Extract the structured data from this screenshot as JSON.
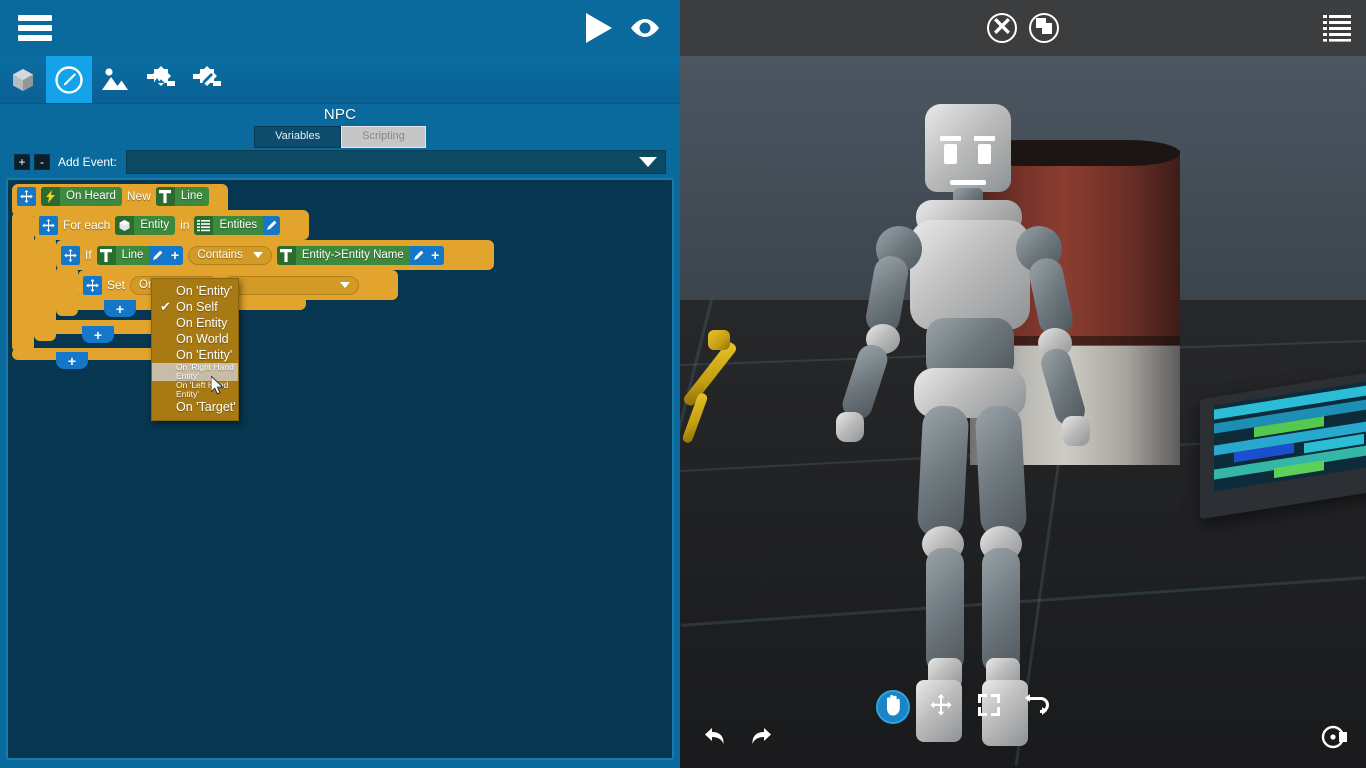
{
  "app": {
    "menu_icon": "hamburger-menu-icon",
    "play_icon": "play-icon",
    "preview_icon": "eye-icon"
  },
  "toolstrip": {
    "items": [
      {
        "icon": "cube-icon",
        "name": "objects-tool",
        "active": false
      },
      {
        "icon": "pencil-circle-icon",
        "name": "edit-tool",
        "active": true
      },
      {
        "icon": "image-icon",
        "name": "scene-tool",
        "active": false
      },
      {
        "icon": "gear-image-icon",
        "name": "settings-scene-tool",
        "active": false
      },
      {
        "icon": "gear-pencil-icon",
        "name": "settings-edit-tool",
        "active": false
      }
    ]
  },
  "object_panel": {
    "title": "NPC",
    "tabs": [
      {
        "label": "Variables",
        "active": false
      },
      {
        "label": "Scripting",
        "active": true
      }
    ]
  },
  "add_event": {
    "add_label": "+",
    "remove_label": "-",
    "label": "Add Event:",
    "value": "",
    "caret": "chevron-down-icon"
  },
  "script": {
    "event_block": {
      "handle": "move-handle-icon",
      "trigger_icon": "lightning-bolt-icon",
      "trigger": "On Heard",
      "mid_label": "New",
      "value_icon": "text-type-icon",
      "value": "Line"
    },
    "foreach_block": {
      "handle": "move-handle-icon",
      "label": "For each",
      "item_icon": "cube-icon",
      "item": "Entity",
      "in_label": "in",
      "list_icon": "list-icon",
      "list": "Entities",
      "edit_icon": "pencil-icon"
    },
    "if_block": {
      "handle": "move-handle-icon",
      "label": "If",
      "left_icon": "text-type-icon",
      "left": "Line",
      "left_edit": "pencil-icon",
      "left_add": "plus-icon",
      "operator": "Contains",
      "right_icon": "text-type-icon",
      "right": "Entity->Entity Name",
      "right_edit": "pencil-icon",
      "right_add": "plus-icon"
    },
    "set_block": {
      "handle": "move-handle-icon",
      "label": "Set",
      "target": "On Self",
      "value": ""
    },
    "add_buttons": [
      {
        "label": "+",
        "name": "add-statement-level-4"
      },
      {
        "label": "+",
        "name": "add-statement-level-3"
      },
      {
        "label": "+",
        "name": "add-statement-level-2"
      },
      {
        "label": "+",
        "name": "add-statement-level-1"
      }
    ]
  },
  "dropdown": {
    "open": true,
    "items": [
      {
        "label": "On 'Entity'",
        "checked": false,
        "small": false,
        "hovered": false
      },
      {
        "label": "On Self",
        "checked": true,
        "small": false,
        "hovered": false
      },
      {
        "label": "On Entity",
        "checked": false,
        "small": false,
        "hovered": false
      },
      {
        "label": "On World",
        "checked": false,
        "small": false,
        "hovered": false
      },
      {
        "label": "On 'Entity'",
        "checked": false,
        "small": false,
        "hovered": false
      },
      {
        "label": "On 'Right Hand Entity'",
        "checked": false,
        "small": true,
        "hovered": true
      },
      {
        "label": "On 'Left Hand Entity'",
        "checked": false,
        "small": true,
        "hovered": false
      },
      {
        "label": "On 'Target'",
        "checked": false,
        "small": false,
        "hovered": false
      }
    ]
  },
  "viewport": {
    "topbar": [
      {
        "icon": "close-circle-icon",
        "name": "close-button"
      },
      {
        "icon": "duplicate-circle-icon",
        "name": "duplicate-button"
      }
    ],
    "list_icon": "list-panel-icon",
    "bottombar": {
      "undo": "undo-icon",
      "redo": "redo-icon",
      "tools": [
        {
          "icon": "hand-icon",
          "name": "pan-tool",
          "active": true
        },
        {
          "icon": "move-arrows-icon",
          "name": "move-tool",
          "active": false
        },
        {
          "icon": "scale-expand-icon",
          "name": "scale-tool",
          "active": false
        },
        {
          "icon": "rotate-loop-icon",
          "name": "rotate-tool",
          "active": false
        }
      ],
      "camera": "camera-settings-icon"
    }
  },
  "colors": {
    "header_blue": "#0a6a9e",
    "accent_blue": "#14a3e8",
    "canvas_navy": "#063650",
    "block_orange": "#e2a42c",
    "chip_green": "#3d8a3f",
    "menu_gold": "#a87a14",
    "viewport_bar": "#3b3d3f"
  }
}
